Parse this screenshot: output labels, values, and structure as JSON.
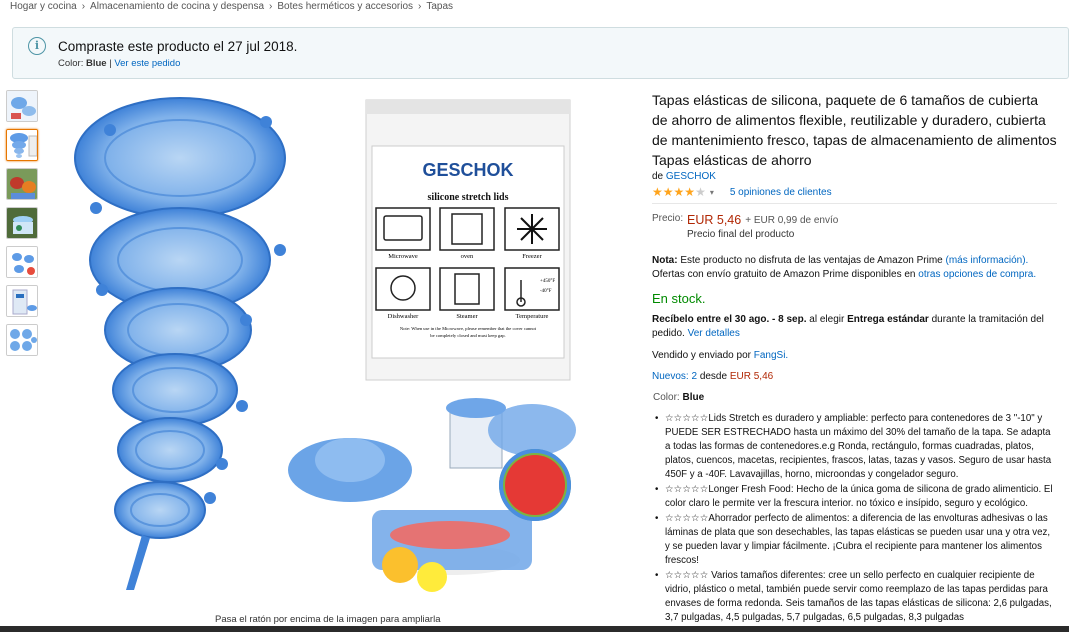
{
  "breadcrumb": [
    "Hogar y cocina",
    "Almacenamiento de cocina y despensa",
    "Botes herméticos y accesorios",
    "Tapas"
  ],
  "breadcrumb_sep": "›",
  "notice": {
    "title": "Compraste este producto el 27 jul 2018.",
    "color_label": "Color:",
    "color_value": "Blue",
    "divider": "|",
    "view_order": "Ver este pedido",
    "icon": "info-icon"
  },
  "image": {
    "brand": "GESCHOK",
    "subtitle": "silicone stretch lids",
    "labels": [
      "Microwave",
      "oven",
      "Freezer",
      "Dishwasher",
      "Steamer",
      "Temperature"
    ],
    "temp_hi": "+450°F",
    "temp_lo": "-40°F",
    "note_line1": "Note: When use in the Microwave, please remember that the cover cannot",
    "note_line2": "be completely closed and must keep gap.",
    "zoom_hint": "Pasa el ratón por encima de la imagen para ampliarla"
  },
  "product": {
    "title": "Tapas elásticas de silicona, paquete de 6 tamaños de cubierta de ahorro de alimentos flexible, reutilizable y duradero, cubierta de mantenimiento fresco, tapas de almacenamiento de alimentos Tapas elásticas de ahorro",
    "by_prefix": "de",
    "brand": "GESCHOK",
    "rating": 4,
    "caret": "▾",
    "reviews": "5 opiniones de clientes",
    "price_label": "Precio:",
    "price": "EUR 5,46",
    "shipping": "+ EUR 0,99 de envío",
    "final_price": "Precio final del producto",
    "note_label": "Nota:",
    "note_text": "Este producto no disfruta de las ventajas de Amazon Prime",
    "note_link": "(más información).",
    "note_line2_a": "Ofertas con envío gratuito de Amazon Prime disponibles en",
    "note_line2_link": "otras opciones de compra.",
    "stock": "En stock.",
    "delivery_a": "Recíbelo entre el 30 ago. - 8 sep.",
    "delivery_b": "al elegir",
    "delivery_c": "Entrega estándar",
    "delivery_d": "durante la tramitación del pedido.",
    "delivery_link": "Ver detalles",
    "sold_a": "Vendido y enviado por",
    "sold_link": "FangSi.",
    "new_a": "Nuevos: 2",
    "new_b": "desde",
    "new_price": "EUR 5,46",
    "color_label": "Color:",
    "color_value": "Blue",
    "bullets": [
      "☆☆☆☆☆Lids Stretch es duradero y ampliable: perfecto para contenedores de 3 \"-10\" y PUEDE SER ESTRECHADO hasta un máximo del 30% del tamaño de la tapa. Se adapta a todas las formas de contenedores.e.g Ronda, rectángulo, formas cuadradas, platos, platos, cuencos, macetas, recipientes, frascos, latas, tazas y vasos. Seguro de usar hasta 450F y a -40F. Lavavajillas, horno, microondas y congelador seguro.",
      "☆☆☆☆☆Longer Fresh Food: Hecho de la única goma de silicona de grado alimenticio. El color claro le permite ver la frescura interior. no tóxico e insípido, seguro y ecológico.",
      "☆☆☆☆☆Ahorrador perfecto de alimentos: a diferencia de las envolturas adhesivas o las láminas de plata que son desechables, las tapas elásticas se pueden usar una y otra vez, y se pueden lavar y limpiar fácilmente. ¡Cubra el recipiente para mantener los alimentos frescos!",
      "☆☆☆☆☆ Varios tamaños diferentes: cree un sello perfecto en cualquier recipiente de vidrio, plástico o metal, también puede servir como reemplazo de las tapas perdidas para envases de forma redonda. Seis tamaños de las tapas elásticas de silicona: 2,6 pulgadas, 3,7 pulgadas, 4,5 pulgadas, 5,7 pulgadas, 6,5 pulgadas, 8,3 pulgadas"
    ]
  },
  "colors": {
    "link": "#0066c0",
    "price": "#b12704",
    "stock": "#008a00",
    "star": "#ffa41c",
    "lid": "#4a8ee0"
  }
}
